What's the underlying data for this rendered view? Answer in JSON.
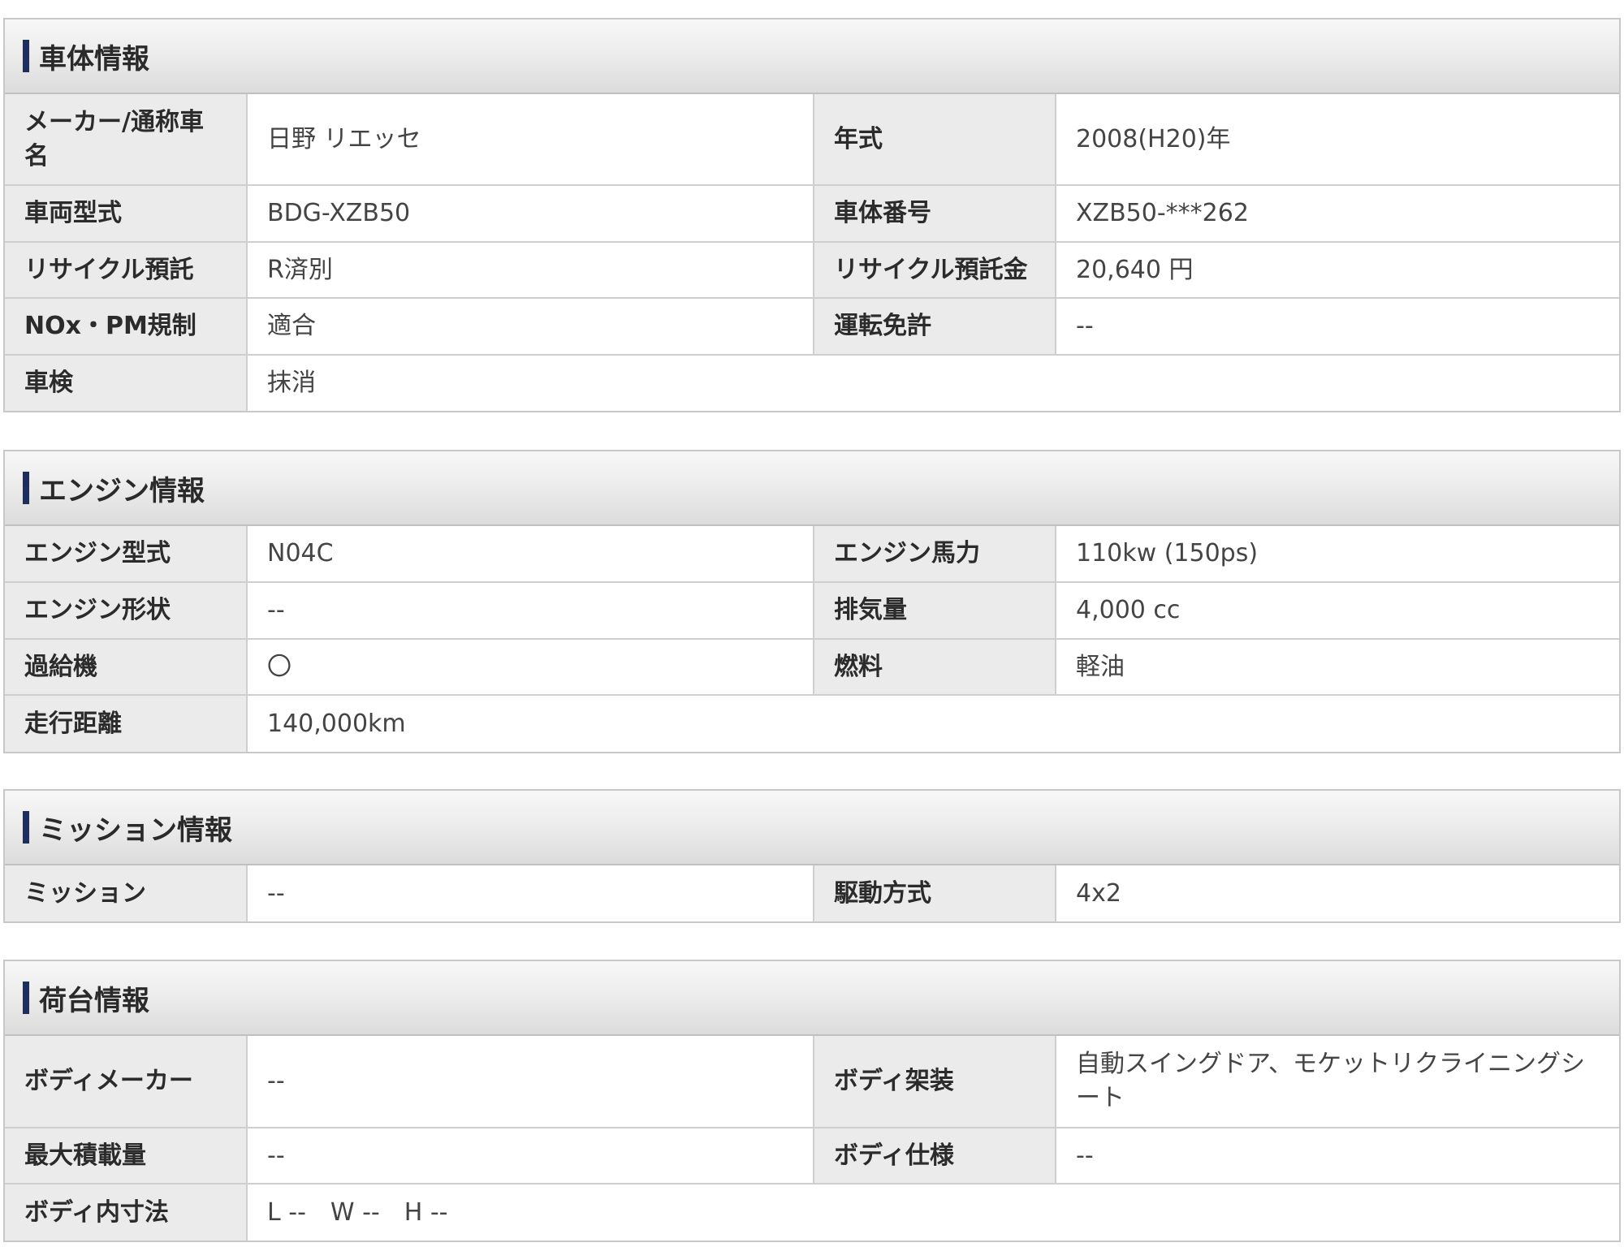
{
  "sections": [
    {
      "title": "車体情報",
      "rows": [
        {
          "l1": "メーカー/通称車名",
          "v1": "日野 リエッセ",
          "l2": "年式",
          "v2": "2008(H20)年"
        },
        {
          "l1": "車両型式",
          "v1": "BDG-XZB50",
          "l2": "車体番号",
          "v2": "XZB50-***262"
        },
        {
          "l1": "リサイクル預託",
          "v1": "R済別",
          "l2": "リサイクル預託金",
          "v2": "20,640 円"
        },
        {
          "l1": "NOx・PM規制",
          "v1": "適合",
          "l2": "運転免許",
          "v2": "--"
        },
        {
          "l1": "車検",
          "v1": "抹消"
        }
      ]
    },
    {
      "title": "エンジン情報",
      "rows": [
        {
          "l1": "エンジン型式",
          "v1": "N04C",
          "l2": "エンジン馬力",
          "v2": "110kw (150ps)"
        },
        {
          "l1": "エンジン形状",
          "v1": "--",
          "l2": "排気量",
          "v2": "4,000 cc"
        },
        {
          "l1": "過給機",
          "v1": "〇",
          "l2": "燃料",
          "v2": "軽油"
        },
        {
          "l1": "走行距離",
          "v1": "140,000km"
        }
      ]
    },
    {
      "title": "ミッション情報",
      "rows": [
        {
          "l1": "ミッション",
          "v1": "--",
          "l2": "駆動方式",
          "v2": "4x2"
        }
      ]
    },
    {
      "title": "荷台情報",
      "rows": [
        {
          "l1": "ボディメーカー",
          "v1": "--",
          "l2": "ボディ架装",
          "v2": "自動スイングドア、モケットリクライニングシート"
        },
        {
          "l1": "最大積載量",
          "v1": "--",
          "l2": "ボディ仕様",
          "v2": "--"
        },
        {
          "l1": "ボディ内寸法",
          "v1": "L --　W --　H --"
        }
      ]
    }
  ]
}
